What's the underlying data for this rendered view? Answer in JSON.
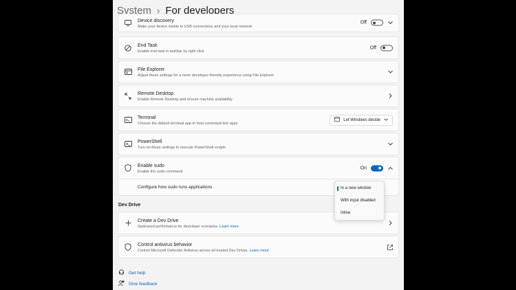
{
  "header": {
    "parent": "System",
    "separator": "›",
    "title": "For developers"
  },
  "settings": [
    {
      "title": "Device discovery",
      "desc": "Make your device visible to USB connections and your local network",
      "state": "Off"
    },
    {
      "title": "End Task",
      "desc": "Enable end task in taskbar by right click",
      "state": "Off"
    },
    {
      "title": "File Explorer",
      "desc": "Adjust these settings for a more developer-friendly experience using File Explorer"
    },
    {
      "title": "Remote Desktop",
      "desc": "Enable Remote Desktop and ensure machine availability"
    },
    {
      "title": "Terminal",
      "desc": "Choose the default terminal app to host command-line apps",
      "dropdown": "Let Windows decide"
    },
    {
      "title": "PowerShell",
      "desc": "Turn on these settings to execute PowerShell scripts"
    },
    {
      "title": "Enable sudo",
      "desc": "Enable the sudo command",
      "state": "On"
    }
  ],
  "sudo_sub": {
    "label": "Configure how sudo runs applications"
  },
  "sudo_menu": {
    "options": [
      "In a new window",
      "With input disabled",
      "Inline"
    ],
    "selected": "In a new window"
  },
  "dev_drive": {
    "section": "Dev Drive",
    "create": {
      "title": "Create a Dev Drive",
      "desc": "Optimized performance for developer scenarios.",
      "link": "Learn more"
    },
    "antivirus": {
      "title": "Control antivirus behavior",
      "desc": "Control Microsoft Defender Antivirus across all trusted Dev Drives.",
      "link": "Learn more"
    }
  },
  "footer": {
    "help": "Get help",
    "feedback": "Give feedback"
  },
  "colors": {
    "accent": "#0067c0",
    "link": "#0f5fc0",
    "background": "#f3f3f3",
    "card": "#fbfbfb"
  }
}
